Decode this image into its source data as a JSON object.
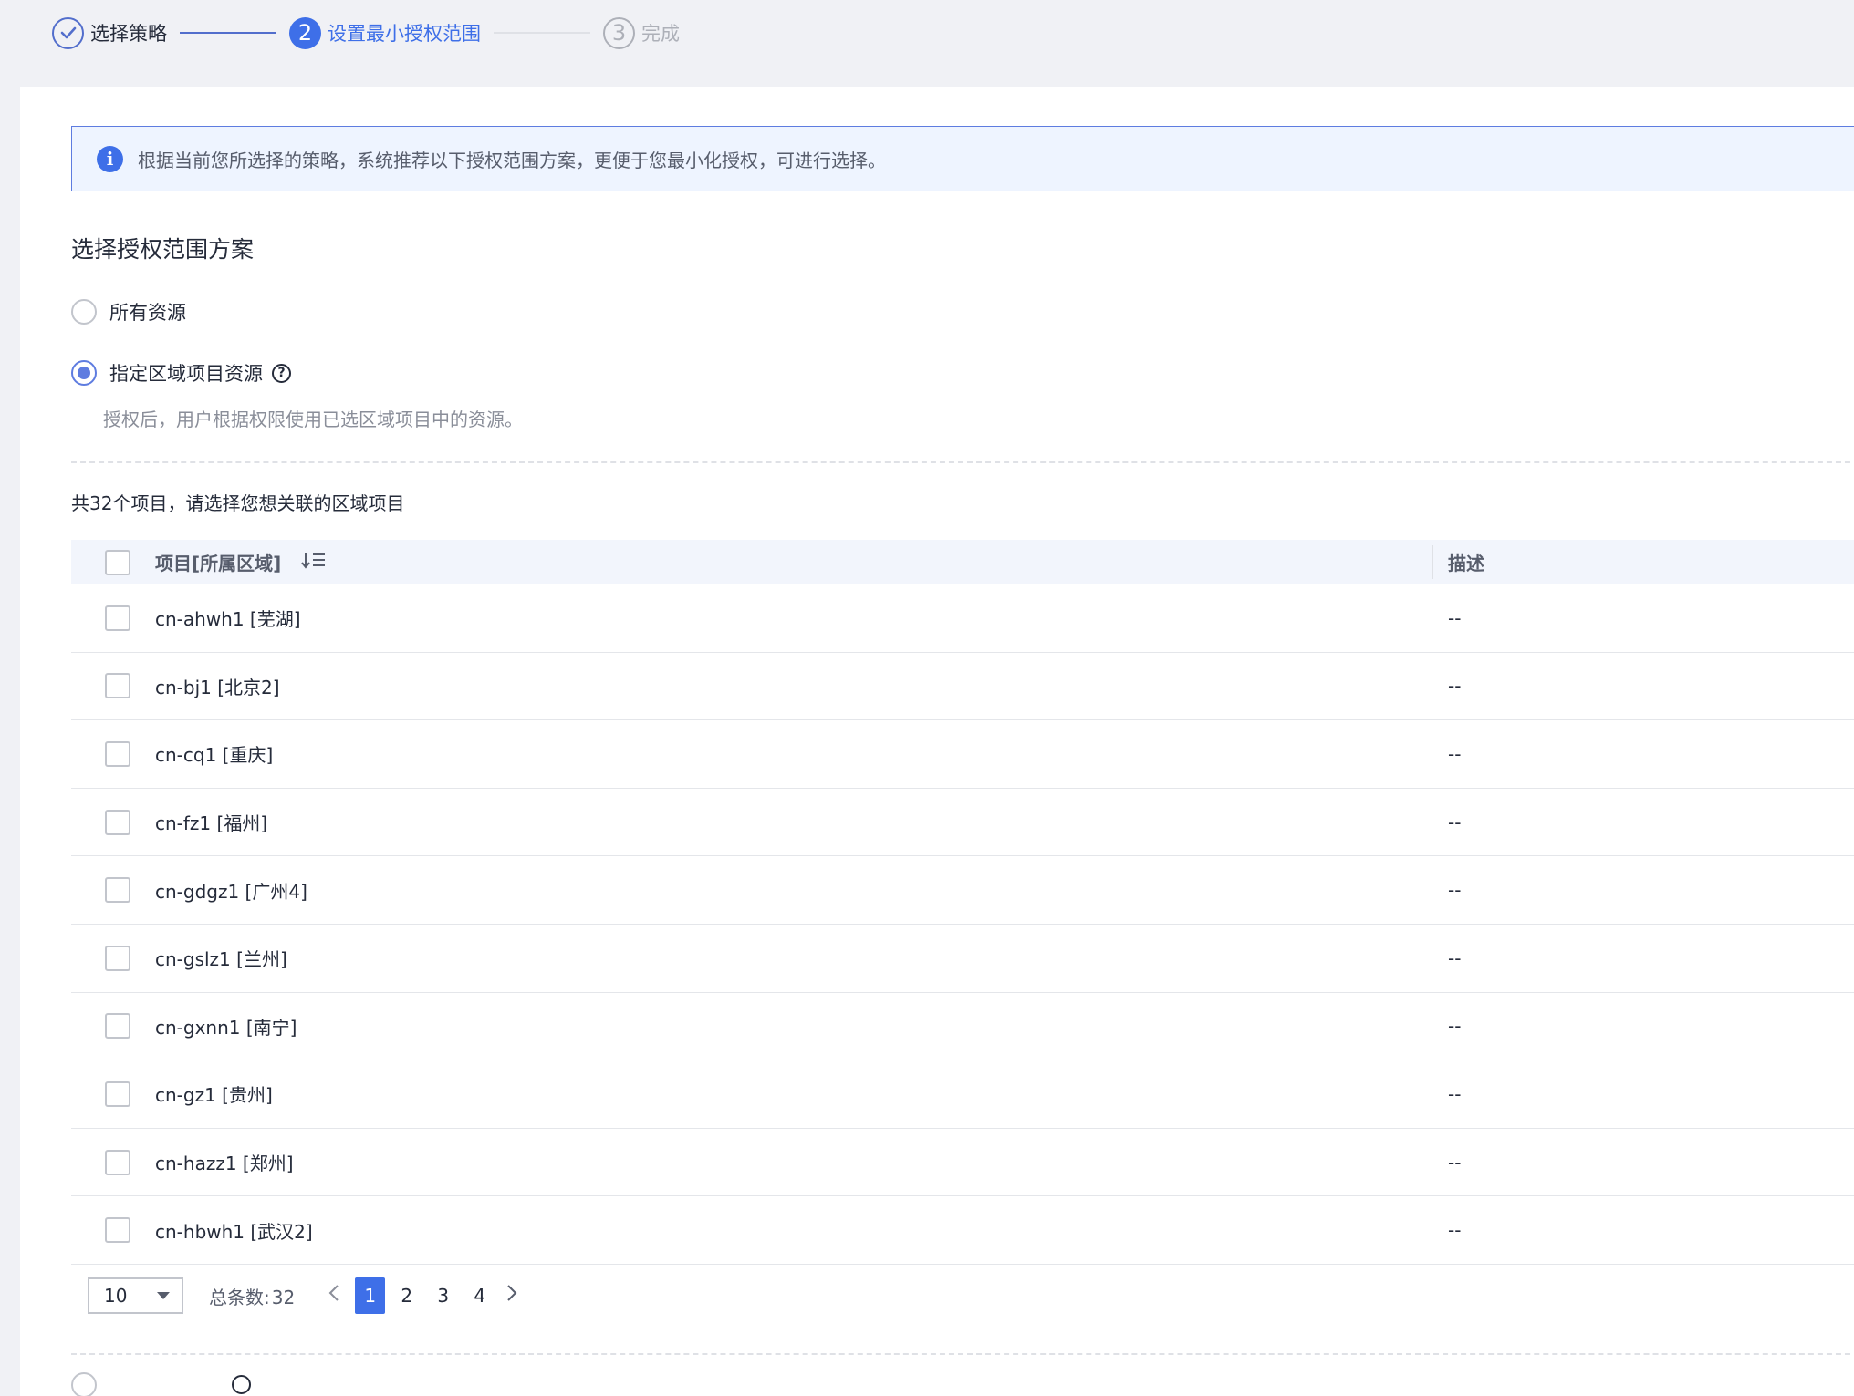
{
  "steps": [
    {
      "number": "",
      "label": "选择策略",
      "state": "done"
    },
    {
      "number": "2",
      "label": "设置最小授权范围",
      "state": "active"
    },
    {
      "number": "3",
      "label": "完成",
      "state": "todo"
    }
  ],
  "info": {
    "icon": "i",
    "text": "根据当前您所选择的策略，系统推荐以下授权范围方案，更便于您最小化授权，可进行选择。"
  },
  "section_title": "选择授权范围方案",
  "options": {
    "all_resources": "所有资源",
    "region_project": "指定区域项目资源",
    "help": "?",
    "region_project_desc": "授权后，用户根据权限使用已选区域项目中的资源。"
  },
  "project_count": "共32个项目，请选择您想关联的区域项目",
  "table": {
    "headers": {
      "project": "项目[所属区域]",
      "description": "描述"
    },
    "rows": [
      {
        "project": "cn-ahwh1 [芜湖]",
        "description": "--"
      },
      {
        "project": "cn-bj1 [北京2]",
        "description": "--"
      },
      {
        "project": "cn-cq1 [重庆]",
        "description": "--"
      },
      {
        "project": "cn-fz1 [福州]",
        "description": "--"
      },
      {
        "project": "cn-gdgz1 [广州4]",
        "description": "--"
      },
      {
        "project": "cn-gslz1 [兰州]",
        "description": "--"
      },
      {
        "project": "cn-gxnn1 [南宁]",
        "description": "--"
      },
      {
        "project": "cn-gz1 [贵州]",
        "description": "--"
      },
      {
        "project": "cn-hazz1 [郑州]",
        "description": "--"
      },
      {
        "project": "cn-hbwh1 [武汉2]",
        "description": "--"
      }
    ]
  },
  "pagination": {
    "page_size": "10",
    "total_label": "总条数:",
    "total": "32",
    "pages": [
      "1",
      "2",
      "3",
      "4"
    ],
    "current": "1"
  },
  "icons": {
    "check": "check-icon",
    "info": "info-icon",
    "help": "help-icon",
    "sort": "sort-icon",
    "caret": "caret-down-icon",
    "prev": "chevron-left-icon",
    "next": "chevron-right-icon"
  },
  "colors": {
    "primary": "#3e6fe8",
    "info_border": "#5e7ce0",
    "info_bg": "#eef4ff",
    "page_bg": "#f0f1f5"
  }
}
